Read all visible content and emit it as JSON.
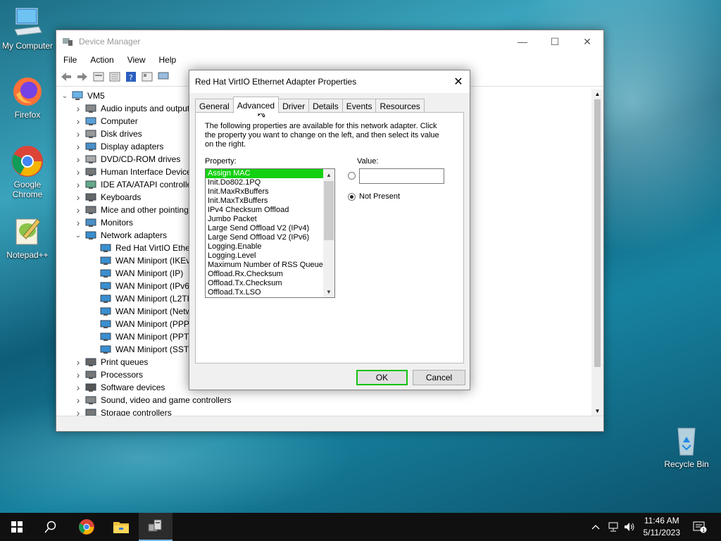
{
  "desktop": {
    "icons": [
      {
        "label": "My Computer"
      },
      {
        "label": "Firefox"
      },
      {
        "label": "Google Chrome"
      },
      {
        "label": "Notepad++"
      },
      {
        "label": "Recycle Bin"
      }
    ]
  },
  "device_manager": {
    "title": "Device Manager",
    "menu": [
      "File",
      "Action",
      "View",
      "Help"
    ],
    "tree": {
      "root": "VM5",
      "items": [
        {
          "label": "Audio inputs and outputs",
          "expanded": false
        },
        {
          "label": "Computer",
          "expanded": false
        },
        {
          "label": "Disk drives",
          "expanded": false
        },
        {
          "label": "Display adapters",
          "expanded": false
        },
        {
          "label": "DVD/CD-ROM drives",
          "expanded": false
        },
        {
          "label": "Human Interface Devices",
          "expanded": false
        },
        {
          "label": "IDE ATA/ATAPI controllers",
          "expanded": false
        },
        {
          "label": "Keyboards",
          "expanded": false
        },
        {
          "label": "Mice and other pointing devices",
          "expanded": false
        },
        {
          "label": "Monitors",
          "expanded": false
        },
        {
          "label": "Network adapters",
          "expanded": true
        },
        {
          "label": "Red Hat VirtIO Ethernet Adapter",
          "child": true
        },
        {
          "label": "WAN Miniport (IKEv2)",
          "child": true
        },
        {
          "label": "WAN Miniport (IP)",
          "child": true
        },
        {
          "label": "WAN Miniport (IPv6)",
          "child": true
        },
        {
          "label": "WAN Miniport (L2TP)",
          "child": true
        },
        {
          "label": "WAN Miniport (Network Monitor)",
          "child": true
        },
        {
          "label": "WAN Miniport (PPPOE)",
          "child": true
        },
        {
          "label": "WAN Miniport (PPTP)",
          "child": true
        },
        {
          "label": "WAN Miniport (SSTP)",
          "child": true
        },
        {
          "label": "Print queues",
          "expanded": false
        },
        {
          "label": "Processors",
          "expanded": false
        },
        {
          "label": "Software devices",
          "expanded": false
        },
        {
          "label": "Sound, video and game controllers",
          "expanded": false
        },
        {
          "label": "Storage controllers",
          "expanded": false
        }
      ]
    }
  },
  "dialog": {
    "title": "Red Hat VirtIO Ethernet Adapter Properties",
    "tabs": [
      "General",
      "Advanced",
      "Driver",
      "Details",
      "Events",
      "Resources"
    ],
    "active_tab": "Advanced",
    "description": "The following properties are available for this network adapter. Click the property you want to change on the left, and then select its value on the right.",
    "property_label": "Property:",
    "value_label": "Value:",
    "properties": [
      "Assign MAC",
      "Init.Do802.1PQ",
      "Init.MaxRxBuffers",
      "Init.MaxTxBuffers",
      "IPv4 Checksum Offload",
      "Jumbo Packet",
      "Large Send Offload V2 (IPv4)",
      "Large Send Offload V2 (IPv6)",
      "Logging.Enable",
      "Logging.Level",
      "Maximum Number of RSS Queues",
      "Offload.Rx.Checksum",
      "Offload.Tx.Checksum",
      "Offload.Tx.LSO"
    ],
    "selected_property": "Assign MAC",
    "value": "",
    "not_present_label": "Not Present",
    "ok_label": "OK",
    "cancel_label": "Cancel"
  },
  "taskbar": {
    "time": "11:46 AM",
    "date": "5/11/2023"
  },
  "colors": {
    "selection": "#13d013",
    "taskbar": "#101010"
  }
}
